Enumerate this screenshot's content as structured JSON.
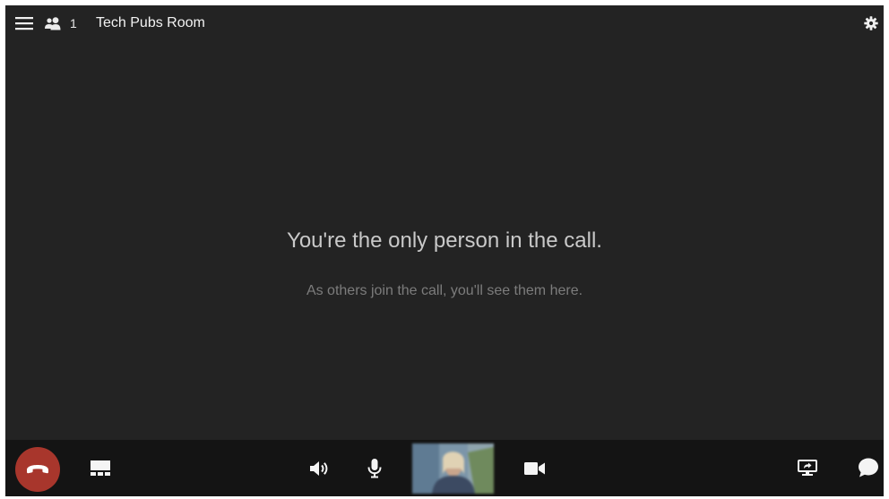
{
  "header": {
    "participant_count": "1",
    "room_name": "Tech Pubs Room"
  },
  "stage": {
    "headline": "You're the only person in the call.",
    "subline": "As others join the call, you'll see them here."
  },
  "icons": {
    "menu": "hamburger-menu-icon",
    "participants": "people-icon",
    "settings": "gear-icon",
    "hangup": "phone-hangup-icon",
    "layout": "layout-icon",
    "speaker": "speaker-icon",
    "mic": "microphone-icon",
    "camera": "video-camera-icon",
    "share": "screen-share-icon",
    "chat": "chat-bubble-icon"
  },
  "colors": {
    "background": "#232323",
    "toolbar": "#141414",
    "hangup": "#a8362c",
    "headline": "#c9c9c9",
    "subline": "#7c7c7c"
  }
}
